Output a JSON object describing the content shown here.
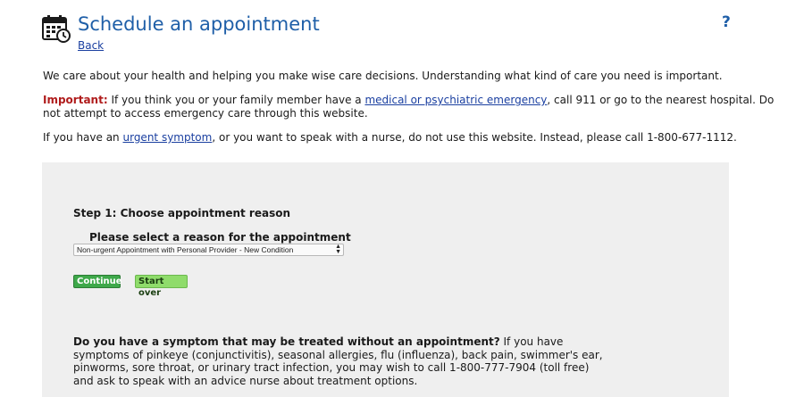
{
  "header": {
    "title": "Schedule an appointment",
    "back_label": "Back",
    "help_label": "?"
  },
  "intro": {
    "text": "We care about your health and helping you make wise care decisions. Understanding what kind of care you need is important."
  },
  "important": {
    "label": "Important:",
    "text_before": " If you think you or your family member have a ",
    "link": "medical or psychiatric emergency",
    "text_after": ", call 911 or go to the nearest hospital. Do not attempt to access emergency care through this website."
  },
  "urgent": {
    "text_before": "If you have an ",
    "link": "urgent symptom",
    "text_after": ", or you want to speak with a nurse, do not use this website. Instead, please call 1-800-677-1112."
  },
  "step1": {
    "title": "Step 1: Choose appointment reason",
    "reason_label": "Please select a reason for the appointment",
    "reason_selected": "Non-urgent Appointment with Personal Provider - New Condition",
    "continue_label": "Continue",
    "start_over_label": "Start over"
  },
  "symptom": {
    "question": "Do you have a symptom that may be treated without an appointment?",
    "text": " If you have symptoms of pinkeye (conjunctivitis), seasonal allergies, flu (influenza), back pain, swimmer's ear, pinworms, sore throat, or urinary tract infection, you may wish to call 1-800-777-7904 (toll free) and ask to speak with an advice nurse about treatment options."
  },
  "colors": {
    "title_blue": "#1f5fa8",
    "link_blue": "#1a3fa0",
    "important_red": "#b01c1c",
    "continue_green": "#3ea84a",
    "start_over_green": "#8fdc6b",
    "panel_gray": "#efefef"
  },
  "icons": {
    "calendar": "calendar-clock-icon",
    "help": "help-icon"
  }
}
